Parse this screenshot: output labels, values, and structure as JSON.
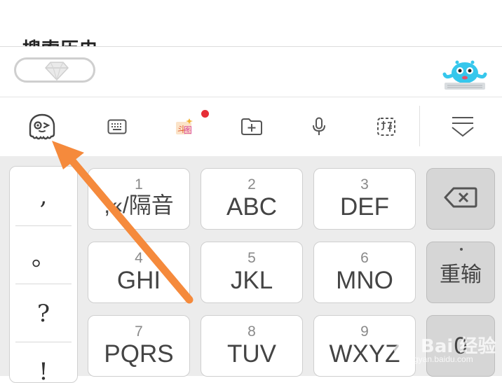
{
  "search_history": {
    "title": "搜索历史"
  },
  "toolbar": {
    "icons": [
      "mascot-face-icon",
      "keyboard-icon",
      "doutu-icon",
      "folder-add-icon",
      "microphone-icon",
      "handwriting-icon",
      "collapse-keyboard-icon"
    ],
    "notification_color": "#e62e37"
  },
  "keyboard": {
    "punctuation": [
      ",",
      "。",
      "?",
      "!"
    ],
    "keys": [
      {
        "num": "1",
        "letters": ",«/隔音"
      },
      {
        "num": "2",
        "letters": "ABC"
      },
      {
        "num": "3",
        "letters": "DEF"
      },
      {
        "num": "4",
        "letters": "GHI"
      },
      {
        "num": "5",
        "letters": "JKL"
      },
      {
        "num": "6",
        "letters": "MNO"
      },
      {
        "num": "7",
        "letters": "PQRS"
      },
      {
        "num": "8",
        "letters": "TUV"
      },
      {
        "num": "9",
        "letters": "WXYZ"
      }
    ],
    "reinput_label": "重输",
    "zero_label": "0"
  },
  "annotation": {
    "arrow_color": "#f58a3c"
  },
  "watermark": {
    "text": "Bai 经验",
    "url": "jingyan.baidu.com"
  }
}
